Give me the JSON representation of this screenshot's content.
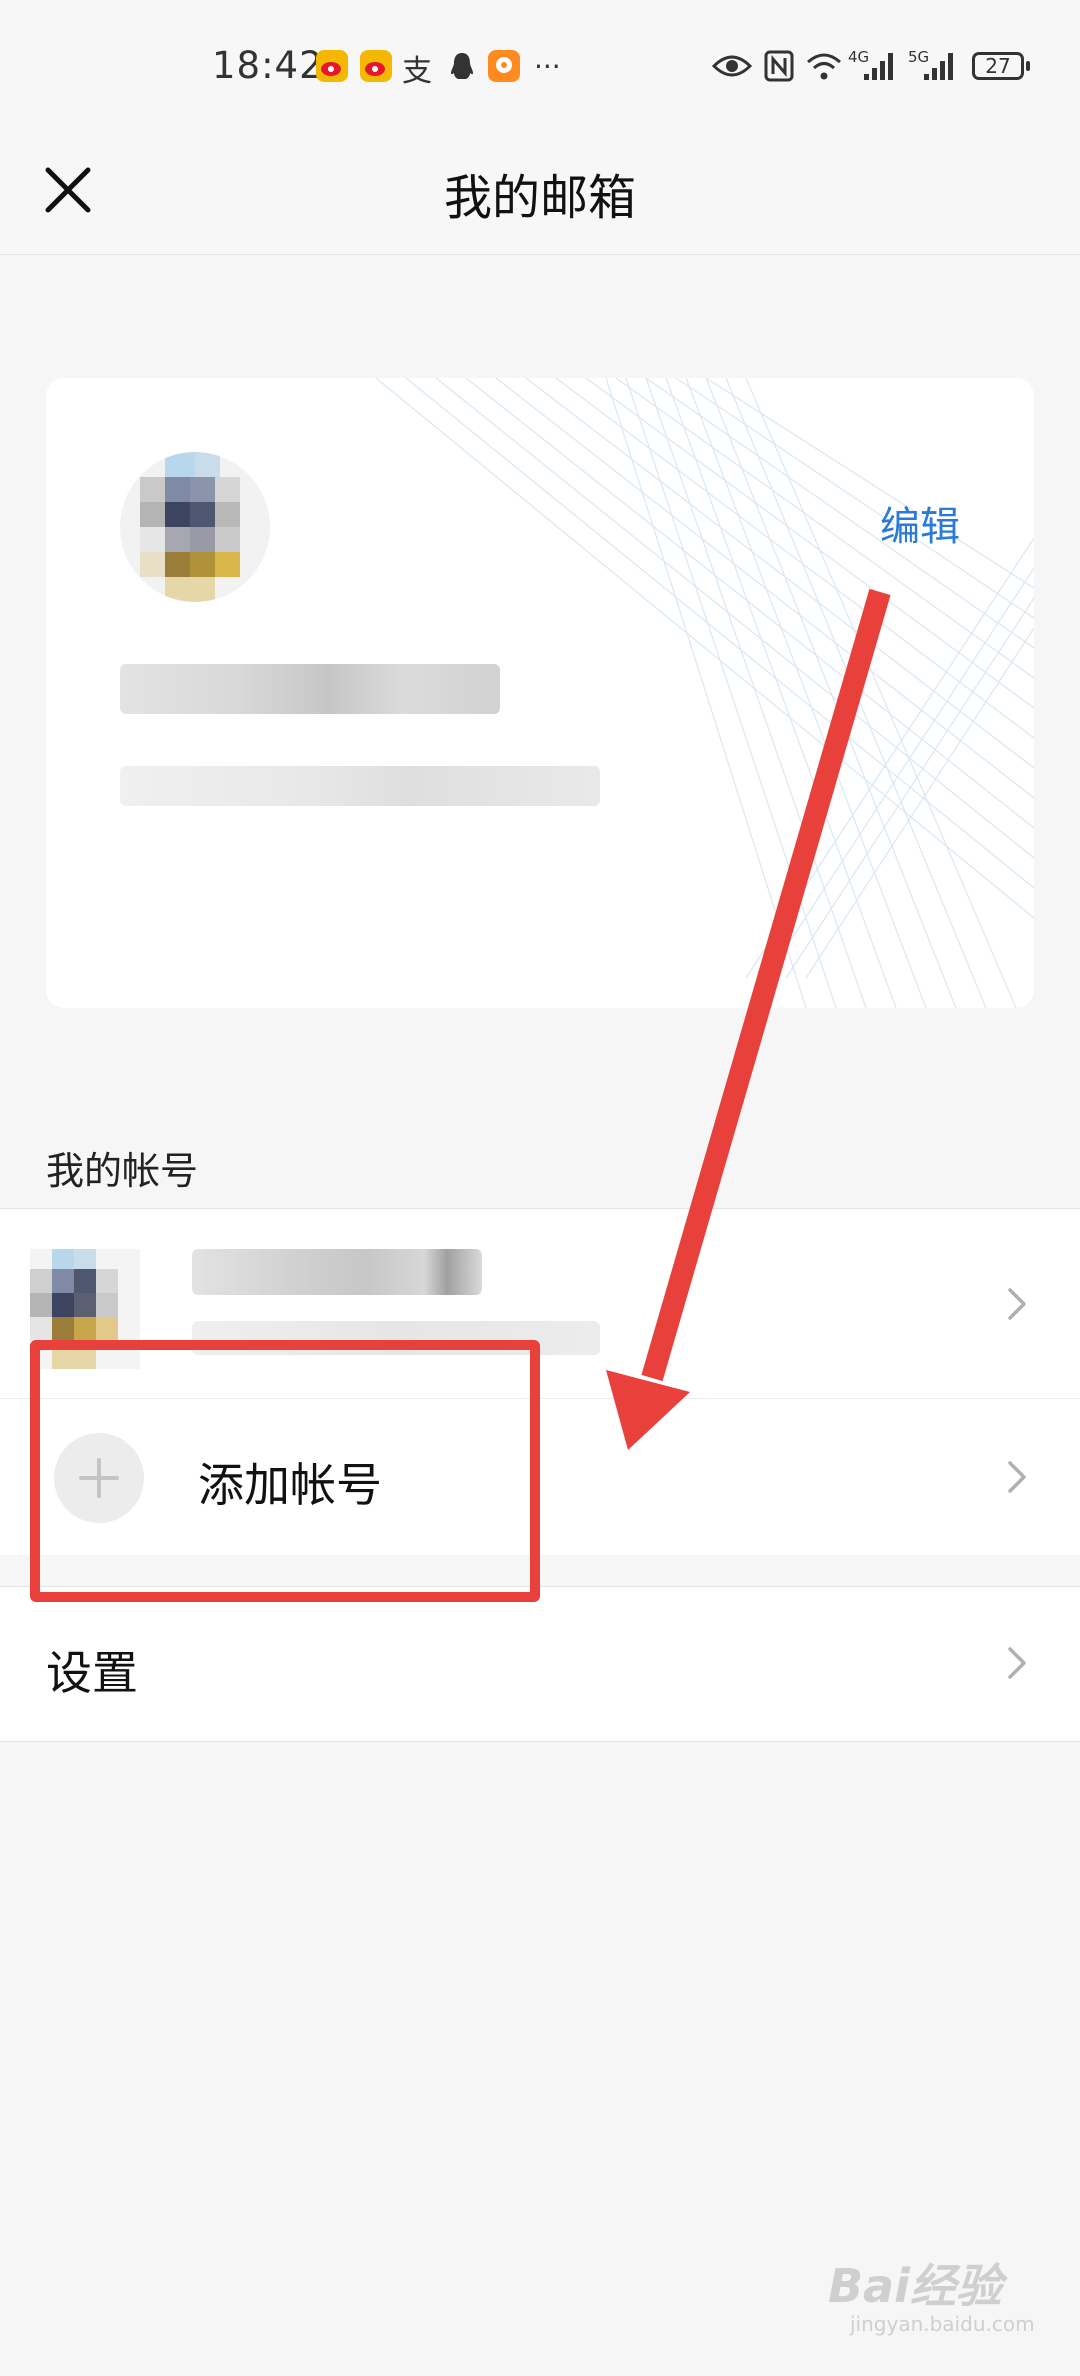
{
  "status_bar": {
    "time": "18:42",
    "more": "···",
    "battery": "27",
    "signal_labels": [
      "4G",
      "5G"
    ],
    "app_icons": [
      "weibo-icon",
      "weibo-icon",
      "alipay-icon",
      "qq-icon",
      "taobao-icon"
    ],
    "right_icons": [
      "eye-icon",
      "nfc-icon",
      "wifi-icon",
      "signal-icon",
      "signal-icon",
      "battery-icon"
    ]
  },
  "header": {
    "title": "我的邮箱",
    "close_icon": "close-icon"
  },
  "profile_card": {
    "edit_label": "编辑",
    "edit_color": "#2a7ad6"
  },
  "accounts": {
    "section_label": "我的帐号",
    "add_account_label": "添加帐号"
  },
  "settings": {
    "label": "设置"
  },
  "annotation": {
    "color": "#e8403a"
  },
  "watermark": {
    "brand": "Bai经验",
    "url": "jingyan.baidu.com"
  }
}
